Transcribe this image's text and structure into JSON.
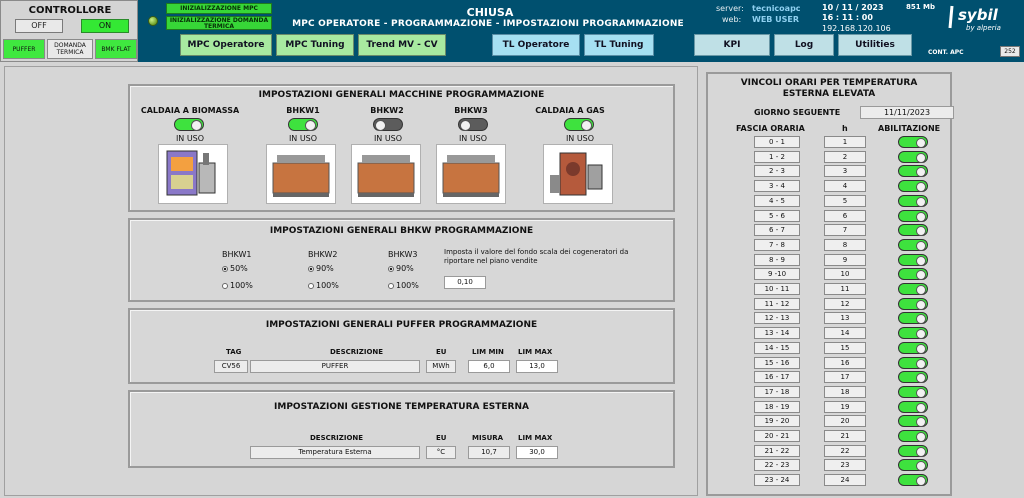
{
  "controller": {
    "title": "CONTROLLORE",
    "off": "OFF",
    "on": "ON",
    "pills": [
      "PUFFER",
      "DOMANDA TERMICA",
      "BMK FLAT"
    ]
  },
  "status": {
    "mpc_init": "INIZIALIZZAZIONE MPC",
    "demand_init": "INIZIALIZZAZIONE DOMANDA TERMICA"
  },
  "header": {
    "title": "CHIUSA",
    "subtitle": "MPC OPERATORE - PROGRAMMAZIONE - IMPOSTAZIONI PROGRAMMAZIONE"
  },
  "nav": [
    {
      "label": "MPC Operatore"
    },
    {
      "label": "MPC Tuning"
    },
    {
      "label": "Trend MV - CV"
    },
    {
      "label": "TL Operatore"
    },
    {
      "label": "TL Tuning"
    },
    {
      "label": "KPI"
    },
    {
      "label": "Log"
    },
    {
      "label": "Utilities"
    }
  ],
  "server": {
    "server_label": "server:",
    "server_value": "tecnicoapc",
    "web_label": "web:",
    "web_value": "WEB USER",
    "date": "10 / 11 / 2023",
    "time": "16 : 11 : 00",
    "ip": "192.168.120.106",
    "memory": "851 Mb",
    "cont_label": "CONT. APC",
    "cont_value": "252"
  },
  "brand": {
    "name": "sybil",
    "by": "by alperia",
    "colors": {
      "header": "#00506f",
      "green": "#3ee23e"
    }
  },
  "machines": {
    "title": "IMPOSTAZIONI GENERALI MACCHINE PROGRAMMAZIONE",
    "items": [
      {
        "name": "CALDAIA A BIOMASSA",
        "state": "IN USO",
        "on": true
      },
      {
        "name": "BHKW1",
        "state": "IN USO",
        "on": true
      },
      {
        "name": "BHKW2",
        "state": "IN USO",
        "on": false
      },
      {
        "name": "BHKW3",
        "state": "IN USO",
        "on": false
      },
      {
        "name": "CALDAIA A GAS",
        "state": "IN USO",
        "on": true
      }
    ]
  },
  "bhkw": {
    "title": "IMPOSTAZIONI GENERALI BHKW PROGRAMMAZIONE",
    "units": [
      {
        "name": "BHKW1",
        "opt1": "50%",
        "opt2": "100%",
        "selected": 1
      },
      {
        "name": "BHKW2",
        "opt1": "90%",
        "opt2": "100%",
        "selected": 1
      },
      {
        "name": "BHKW3",
        "opt1": "90%",
        "opt2": "100%",
        "selected": 1
      }
    ],
    "note": "Imposta il valore del fondo scala dei cogeneratori da riportare nel piano vendite",
    "value": "0,10"
  },
  "puffer": {
    "title": "IMPOSTAZIONI GENERALI PUFFER PROGRAMMAZIONE",
    "headers": {
      "tag": "TAG",
      "desc": "DESCRIZIONE",
      "eu": "EU",
      "min": "LIM MIN",
      "max": "LIM MAX"
    },
    "row": {
      "tag": "CV56",
      "desc": "PUFFER",
      "eu": "MWh",
      "min": "6,0",
      "max": "13,0"
    }
  },
  "temp": {
    "title": "IMPOSTAZIONI GESTIONE TEMPERATURA ESTERNA",
    "headers": {
      "desc": "DESCRIZIONE",
      "eu": "EU",
      "measure": "MISURA",
      "max": "LIM MAX"
    },
    "row": {
      "desc": "Temperatura Esterna",
      "eu": "°C",
      "measure": "10,7",
      "max": "30,0"
    }
  },
  "hours": {
    "title": "VINCOLI ORARI PER TEMPERATURA ESTERNA ELEVATA",
    "next_label": "GIORNO SEGUENTE",
    "next_date": "11/11/2023",
    "col_band": "FASCIA ORARIA",
    "col_h": "h",
    "col_enable": "ABILITAZIONE",
    "bands": [
      "0 - 1",
      "1 - 2",
      "2 - 3",
      "3 - 4",
      "4 - 5",
      "5 - 6",
      "6 - 7",
      "7 - 8",
      "8 - 9",
      "9 -10",
      "10 - 11",
      "11 - 12",
      "12 - 13",
      "13 - 14",
      "14 - 15",
      "15 - 16",
      "16 - 17",
      "17 - 18",
      "18 - 19",
      "19 - 20",
      "20 - 21",
      "21 - 22",
      "22 - 23",
      "23 - 24"
    ],
    "hours": [
      "1",
      "2",
      "3",
      "4",
      "5",
      "6",
      "7",
      "8",
      "9",
      "10",
      "11",
      "12",
      "13",
      "14",
      "15",
      "16",
      "17",
      "18",
      "19",
      "20",
      "21",
      "22",
      "23",
      "24"
    ]
  }
}
